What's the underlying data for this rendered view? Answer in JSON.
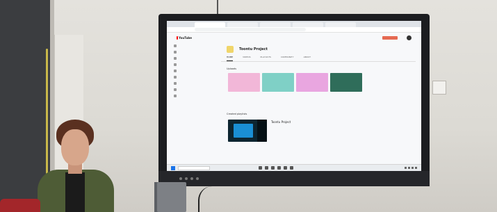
{
  "tv": {
    "channel_title": "Toontu Project",
    "tabs": [
      "HOME",
      "VIDEOS",
      "PLAYLISTS",
      "COMMUNITY",
      "ABOUT"
    ],
    "active_tab": "HOME",
    "uploads_label": "Uploads",
    "playlists_label": "Created playlists",
    "playlist_title": "Toontu Project",
    "logo_text": "YouTube"
  },
  "colors": {
    "youtube_red": "#ff0000",
    "thumb_1": "#f2b7d8",
    "thumb_2": "#7fd0c6",
    "thumb_3": "#e9a6e0",
    "thumb_4": "#2f6d5a",
    "playlist_bg": "#0d2530"
  },
  "icons": [
    "youtube-logo-icon",
    "windows-start-icon",
    "avatar-icon"
  ]
}
